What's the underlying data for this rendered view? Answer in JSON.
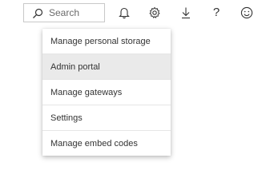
{
  "header": {
    "search": {
      "placeholder": "Search",
      "icon": "search-icon"
    },
    "icons": [
      {
        "name": "bell-icon"
      },
      {
        "name": "gear-icon"
      },
      {
        "name": "download-icon"
      },
      {
        "name": "help-icon",
        "glyph": "?"
      },
      {
        "name": "smiley-icon"
      }
    ]
  },
  "menu": {
    "items": [
      {
        "label": "Manage personal storage"
      },
      {
        "label": "Admin portal",
        "active": true
      },
      {
        "label": "Manage gateways"
      },
      {
        "label": "Settings"
      },
      {
        "label": "Manage embed codes"
      }
    ]
  },
  "colors": {
    "text": "#333333",
    "placeholder": "#6b6b6b",
    "hover_bg": "#eaeaea",
    "divider": "#e6e6e6"
  }
}
